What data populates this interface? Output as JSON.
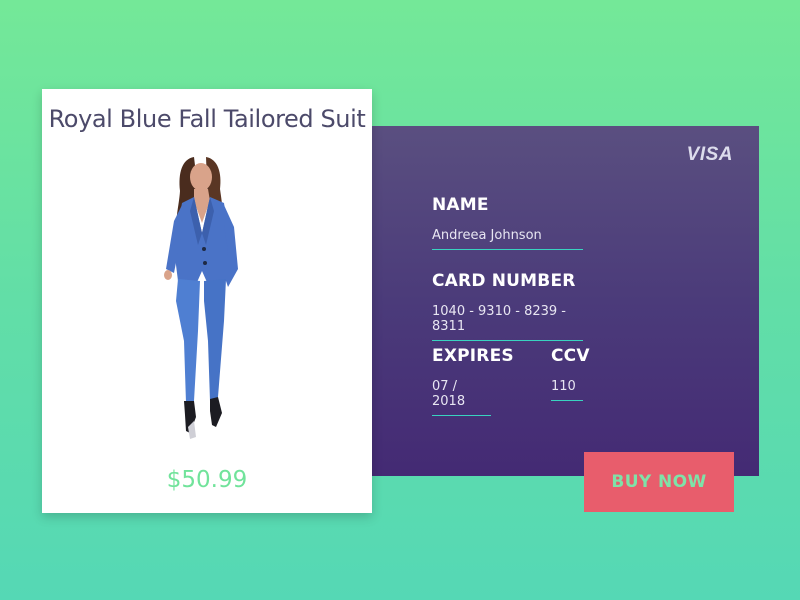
{
  "product": {
    "title": "Royal Blue Fall Tailored Suit",
    "price": "$50.99",
    "image_alt": "woman-in-blue-suit"
  },
  "payment": {
    "card_brand": "VISA",
    "name_label": "NAME",
    "name_value": "Andreea Johnson",
    "card_number_label": "CARD NUMBER",
    "card_number_value": "1040 - 9310 - 8239 - 8311",
    "expires_label": "EXPIRES",
    "expires_value": "07 / 2018",
    "ccv_label": "CCV",
    "ccv_value": "110"
  },
  "actions": {
    "buy_label": "BUY NOW"
  },
  "colors": {
    "background_top": "#74e898",
    "background_bottom": "#55d8b5",
    "panel_top": "#5a4f80",
    "panel_bottom": "#442a74",
    "accent_underline": "#39d3c0",
    "buy_button": "#e85d6c",
    "price_text": "#71e39b"
  }
}
